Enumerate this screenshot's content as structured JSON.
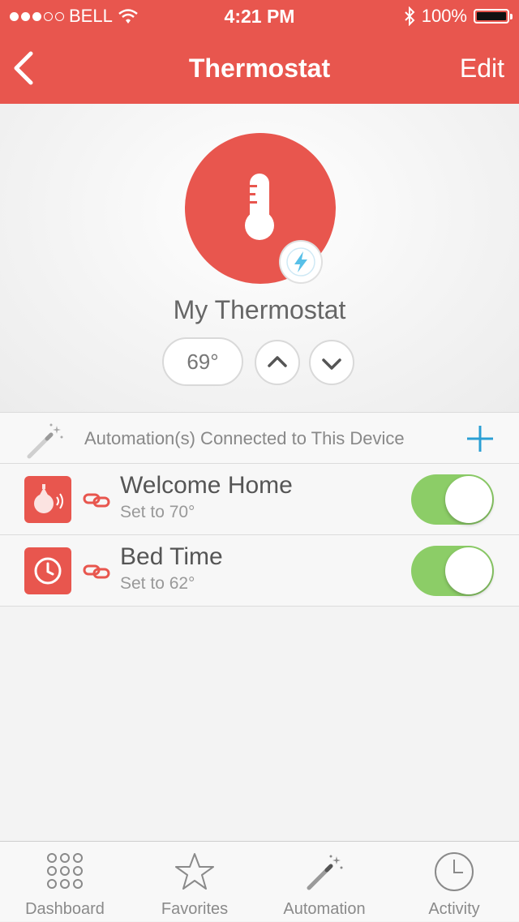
{
  "status_bar": {
    "carrier": "BELL",
    "time": "4:21 PM",
    "battery": "100%",
    "signal_bars_filled": 3,
    "signal_bars_total": 5,
    "icons": [
      "wifi-icon",
      "bluetooth-icon",
      "battery-icon"
    ]
  },
  "nav": {
    "title": "Thermostat",
    "edit_label": "Edit",
    "back_icon": "chevron-left-icon"
  },
  "device": {
    "name": "My Thermostat",
    "temperature": "69°",
    "icon": "thermometer-icon",
    "badge_icon": "lightning-bolt-icon"
  },
  "automations": {
    "header": "Automation(s) Connected to This Device",
    "items": [
      {
        "title": "Welcome Home",
        "subtitle": "Set to 70°",
        "icon": "presence-sensor-icon",
        "enabled": true
      },
      {
        "title": "Bed Time",
        "subtitle": "Set to 62°",
        "icon": "clock-icon",
        "enabled": true
      }
    ]
  },
  "tabs": [
    {
      "label": "Dashboard",
      "icon": "grid-dots-icon"
    },
    {
      "label": "Favorites",
      "icon": "star-icon"
    },
    {
      "label": "Automation",
      "icon": "magic-wand-icon"
    },
    {
      "label": "Activity",
      "icon": "clock-icon"
    }
  ],
  "colors": {
    "accent": "#e8564e",
    "toggle_on": "#8ccd67",
    "add_button": "#2b9fd4",
    "bolt": "#58c0e8"
  }
}
